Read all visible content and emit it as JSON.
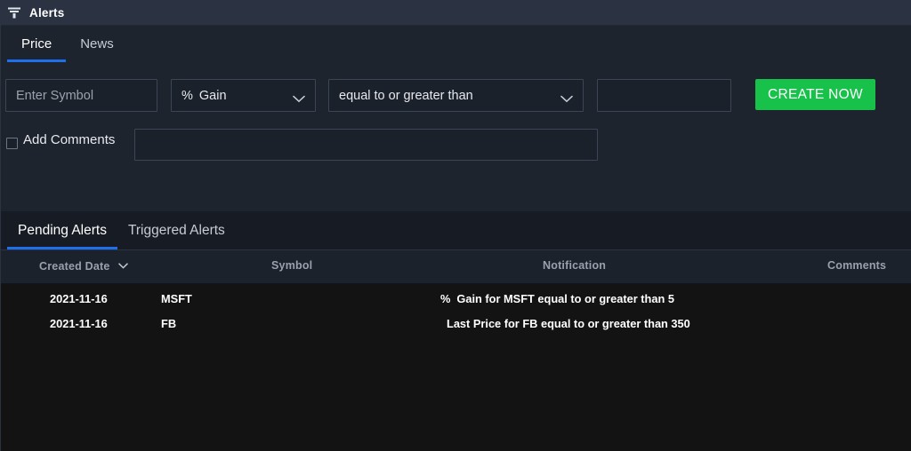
{
  "titlebar": {
    "icon": "funnel-icon",
    "title": "Alerts"
  },
  "top_tabs": [
    {
      "label": "Price",
      "active": true
    },
    {
      "label": "News",
      "active": false
    }
  ],
  "form": {
    "symbol": {
      "value": "",
      "placeholder": "Enter Symbol"
    },
    "alert_type": {
      "prefix": "%",
      "value": "Gain",
      "icon": "chevron-down-icon"
    },
    "condition": {
      "value": "equal to or greater than",
      "icon": "chevron-down-icon"
    },
    "threshold": {
      "value": "",
      "placeholder": ""
    },
    "create_button": "CREATE NOW",
    "add_comments": {
      "label": "Add Comments",
      "checked": false
    },
    "comment": {
      "value": "",
      "placeholder": ""
    }
  },
  "bottom_tabs": [
    {
      "label": "Pending Alerts",
      "active": true
    },
    {
      "label": "Triggered Alerts",
      "active": false
    }
  ],
  "table": {
    "columns": [
      {
        "key": "created_date",
        "label": "Created Date",
        "sort_icon": "chevron-down-icon"
      },
      {
        "key": "symbol",
        "label": "Symbol"
      },
      {
        "key": "notification",
        "label": "Notification"
      },
      {
        "key": "comments",
        "label": "Comments"
      }
    ],
    "rows": [
      {
        "created_date": "2021-11-16",
        "symbol": "MSFT",
        "notification_prefix": "%",
        "notification": "Gain for MSFT equal to or greater than 5",
        "comments": ""
      },
      {
        "created_date": "2021-11-16",
        "symbol": "FB",
        "notification_prefix": "",
        "notification": "Last Price for FB equal to or greater than 350",
        "comments": ""
      }
    ]
  },
  "colors": {
    "accent_blue": "#1f6feb",
    "create_green": "#18c24a",
    "titlebar_bg": "#2b3343",
    "form_bg": "#1e242e",
    "table_bg": "#131313",
    "header_bg": "#1c222c"
  }
}
